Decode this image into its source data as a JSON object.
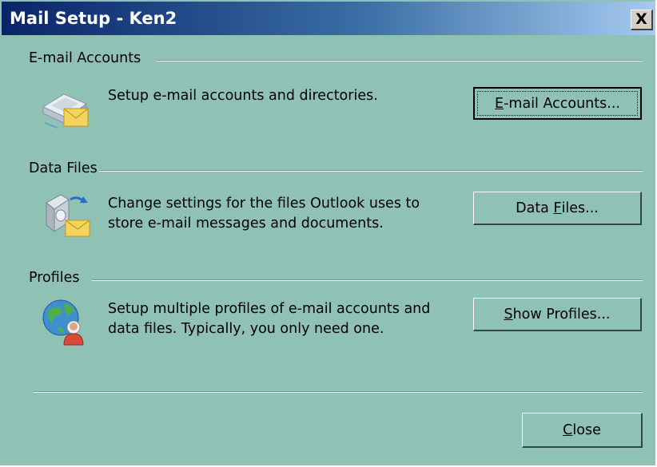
{
  "window": {
    "title": "Mail Setup - Ken2",
    "close_glyph": "X"
  },
  "sections": {
    "email": {
      "header": "E-mail Accounts",
      "description_lines": [
        "Setup e-mail accounts and directories."
      ],
      "button_label_pre": "",
      "button_label_mnemonic": "E",
      "button_label_post": "-mail Accounts...",
      "icon": "email-accounts-icon"
    },
    "data": {
      "header": "Data Files",
      "description_lines": [
        "Change settings for the files Outlook uses to",
        "store e-mail messages and documents."
      ],
      "button_label_pre": "Data ",
      "button_label_mnemonic": "F",
      "button_label_post": "iles...",
      "icon": "data-files-icon"
    },
    "profiles": {
      "header": "Profiles",
      "description_lines": [
        "Setup multiple profiles of e-mail accounts and",
        "data files. Typically, you only need one."
      ],
      "button_label_pre": "",
      "button_label_mnemonic": "S",
      "button_label_post": "how Profiles...",
      "icon": "profiles-icon"
    }
  },
  "footer": {
    "close_pre": "",
    "close_mnemonic": "C",
    "close_post": "lose"
  },
  "colors": {
    "dialog_background": "#8fc1b5",
    "titlebar_start": "#0a246a",
    "titlebar_end": "#a6caf0"
  }
}
